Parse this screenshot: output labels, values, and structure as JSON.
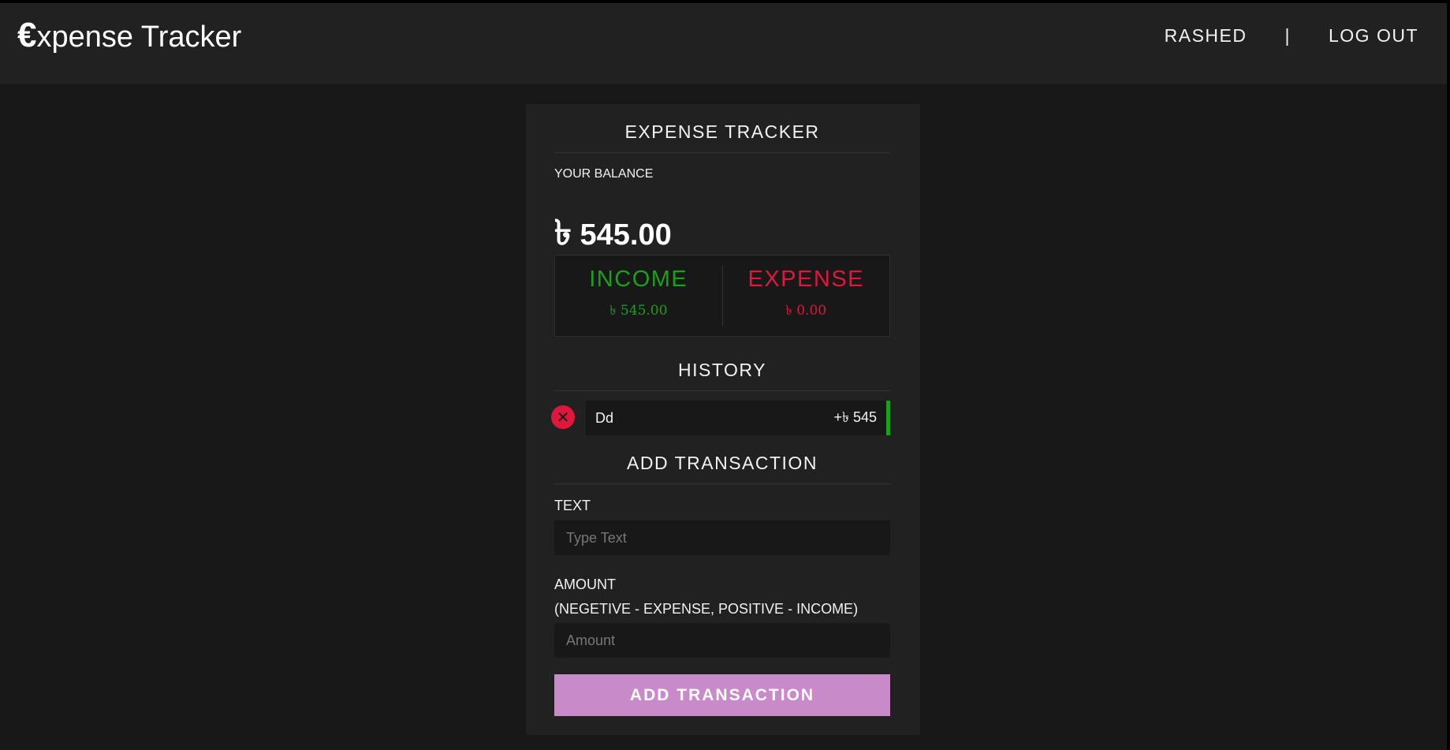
{
  "nav": {
    "brand_symbol": "€",
    "brand_text": "xpense Tracker",
    "username": "RASHED",
    "separator": "|",
    "logout_label": "LOG OUT"
  },
  "card": {
    "title": "EXPENSE TRACKER",
    "balance_label": "YOUR BALANCE",
    "currency_symbol": "৳",
    "balance_value": "545.00",
    "income_label": "INCOME",
    "income_value": "৳ 545.00",
    "expense_label": "EXPENSE",
    "expense_value": "৳ 0.00",
    "history_title": "HISTORY",
    "history": [
      {
        "text": "Dd",
        "amount": "+৳ 545",
        "type": "income"
      }
    ],
    "delete_icon": "close-icon",
    "add_title": "ADD TRANSACTION",
    "text_label": "TEXT",
    "text_placeholder": "Type Text",
    "amount_label": "AMOUNT",
    "amount_hint": "(NEGETIVE - EXPENSE, POSITIVE - INCOME)",
    "amount_placeholder": "Amount",
    "submit_label": "ADD TRANSACTION"
  },
  "colors": {
    "income": "#1aa11a",
    "expense": "#e0173d",
    "button": "#c88ac8",
    "background": "#181818",
    "panel": "#212121"
  }
}
